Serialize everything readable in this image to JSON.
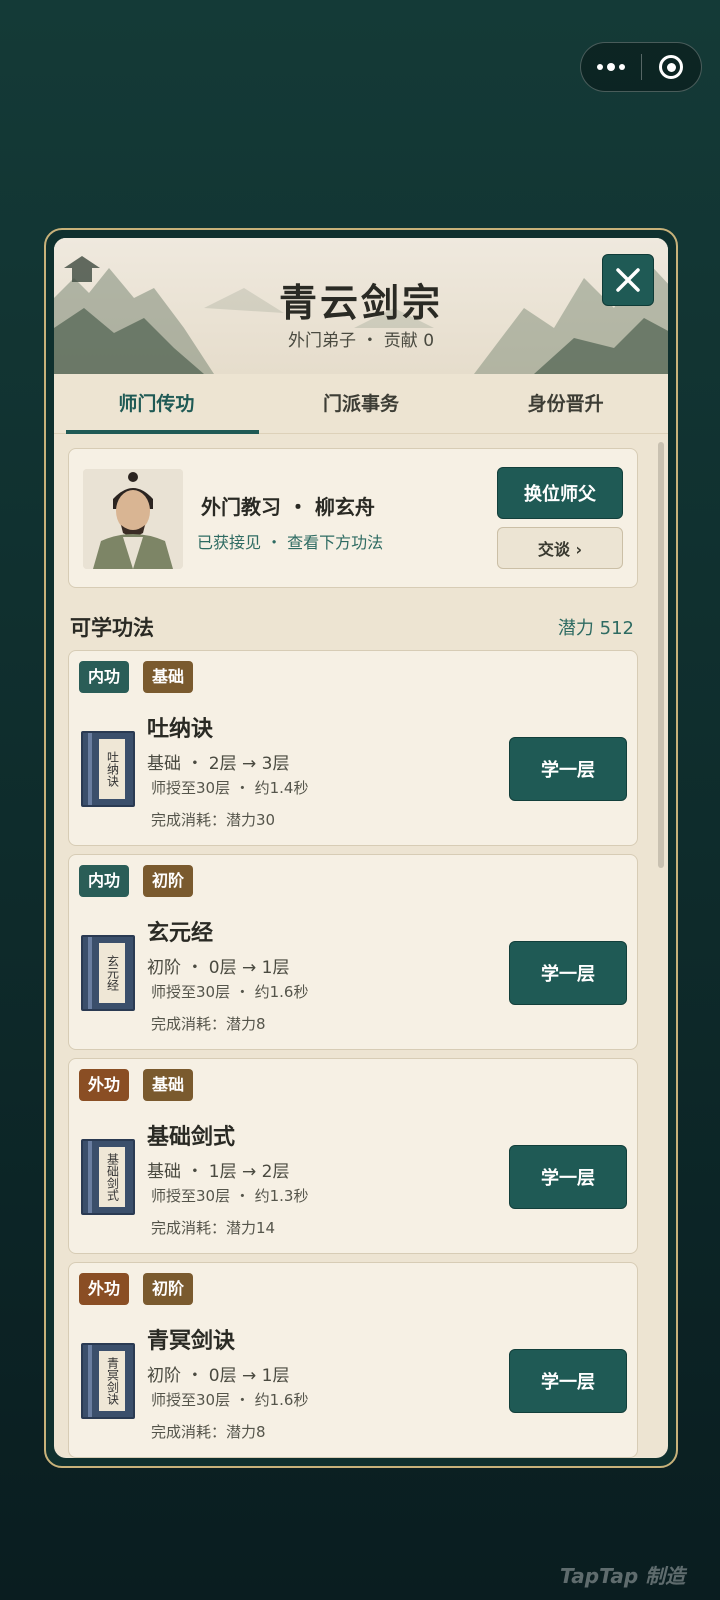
{
  "sect": {
    "title": "青云剑宗",
    "subtitle": "外门弟子 ・ 贡献 0"
  },
  "tabs": [
    {
      "label": "师门传功"
    },
    {
      "label": "门派事务"
    },
    {
      "label": "身份晋升"
    }
  ],
  "master": {
    "name": "外门教习 ・ 柳玄舟",
    "status": "已获接见 ・ 查看下方功法",
    "switch_label": "换位师父",
    "talk_label": "交谈 ›"
  },
  "skills_section": {
    "title": "可学功法",
    "potential": "潜力 512"
  },
  "skills": [
    {
      "tags": [
        "内功",
        "基础"
      ],
      "book": "吐纳诀",
      "name": "吐纳诀",
      "level": "基础 ・ 2层 → 3层",
      "time": "师授至30层 ・ 约1.4秒",
      "cost": "完成消耗：潜力30",
      "button": "学一层"
    },
    {
      "tags": [
        "内功",
        "初阶"
      ],
      "book": "玄元经",
      "name": "玄元经",
      "level": "初阶 ・ 0层 → 1层",
      "time": "师授至30层 ・ 约1.6秒",
      "cost": "完成消耗：潜力8",
      "button": "学一层"
    },
    {
      "tags": [
        "外功",
        "基础"
      ],
      "book": "基础剑式",
      "name": "基础剑式",
      "level": "基础 ・ 1层 → 2层",
      "time": "师授至30层 ・ 约1.3秒",
      "cost": "完成消耗：潜力14",
      "button": "学一层"
    },
    {
      "tags": [
        "外功",
        "初阶"
      ],
      "book": "青冥剑诀",
      "name": "青冥剑诀",
      "level": "初阶 ・ 0层 → 1层",
      "time": "师授至30层 ・ 约1.6秒",
      "cost": "完成消耗：潜力8",
      "button": "学一层"
    }
  ],
  "watermark": "TapTap 制造",
  "colors": {
    "accent": "#1f5a55",
    "panel": "#ede4d2",
    "card": "#f6f0e4",
    "tag_teal": "#2a5d57",
    "tag_brown": "#7a5a2e",
    "tag_rust": "#8a4e24"
  }
}
